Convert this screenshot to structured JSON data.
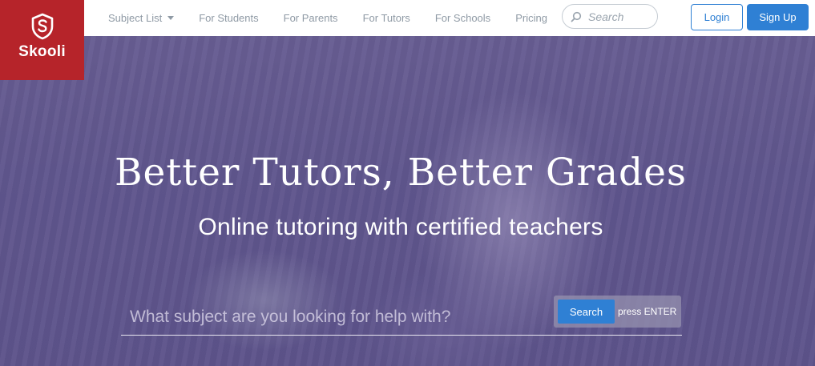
{
  "brand": {
    "name": "Skooli",
    "color": "#b6242a",
    "icon": "shield-s-icon"
  },
  "nav": {
    "items": [
      {
        "label": "Subject List",
        "has_dropdown": true
      },
      {
        "label": "For Students"
      },
      {
        "label": "For Parents"
      },
      {
        "label": "For Tutors"
      },
      {
        "label": "For Schools"
      },
      {
        "label": "Pricing"
      }
    ],
    "search_placeholder": "Search",
    "login_label": "Login",
    "signup_label": "Sign Up"
  },
  "hero": {
    "title": "Better Tutors, Better Grades",
    "subtitle": "Online tutoring with certified teachers",
    "subject_placeholder": "What subject are you looking for help with?",
    "search_button": "Search",
    "enter_hint": "press ENTER"
  },
  "colors": {
    "accent": "#2f80d4",
    "nav_text": "#8f9aa5",
    "hero_overlay": "#584c8a"
  }
}
